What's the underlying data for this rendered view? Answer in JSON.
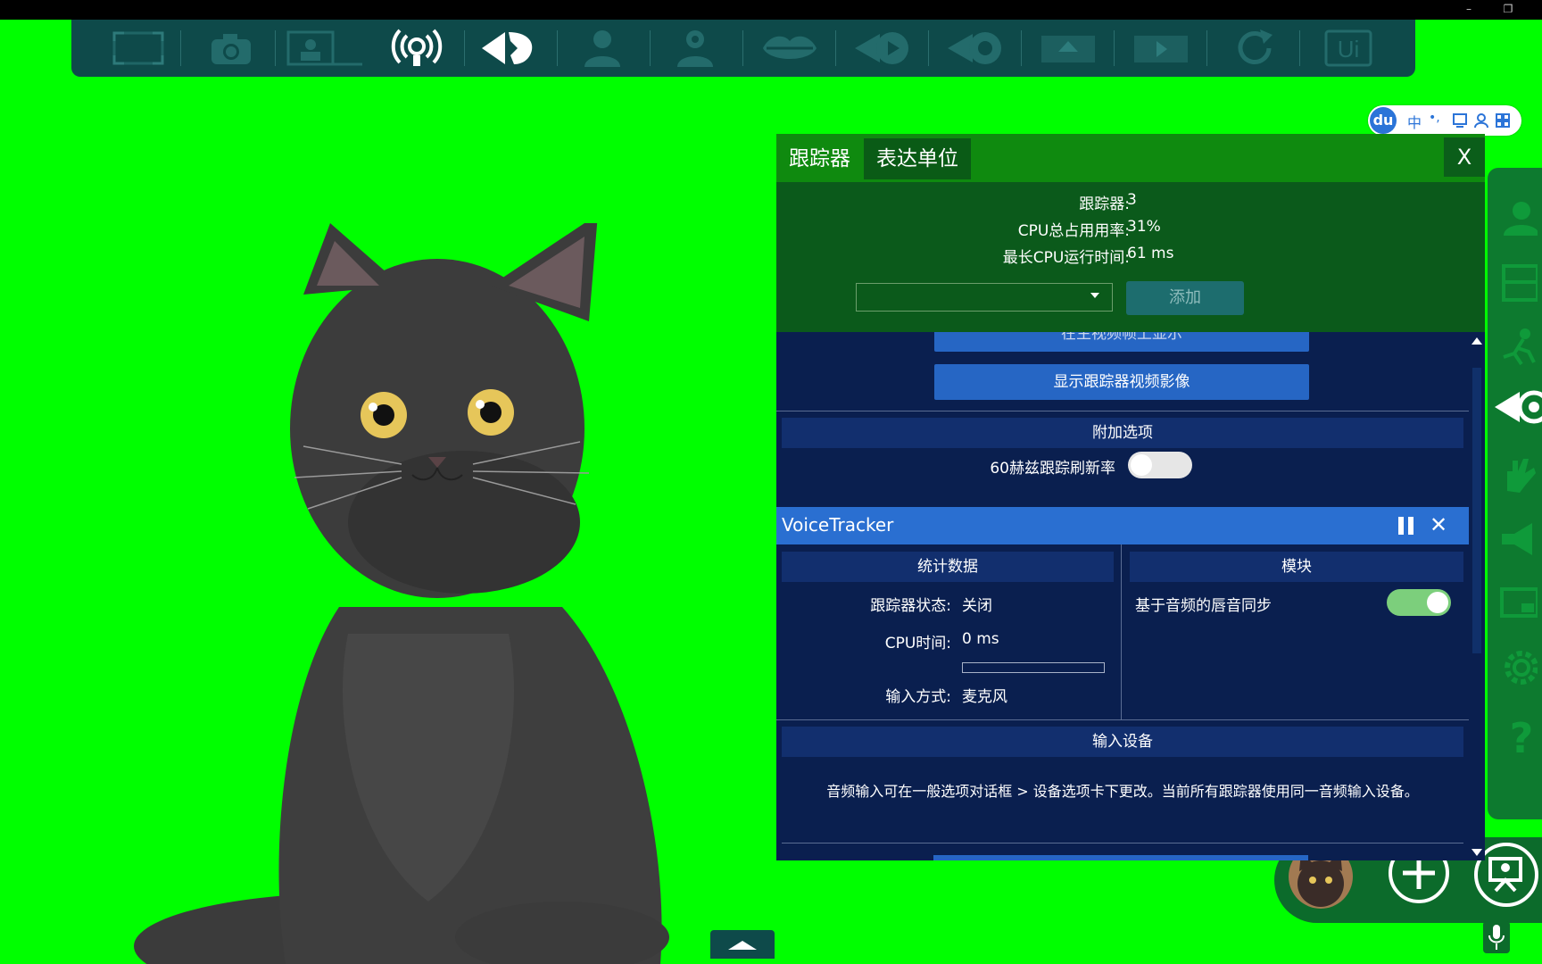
{
  "panel": {
    "tabs": [
      "跟踪器",
      "表达单位"
    ],
    "close_label": "X",
    "stats": {
      "trackers_label": "跟踪器:",
      "trackers_value": "3",
      "cpu_total_label": "CPU总占用用率:",
      "cpu_total_value": "31%",
      "max_cpu_label": "最长CPU运行时间:",
      "max_cpu_value": "61 ms"
    },
    "add_label": "添加",
    "show_main_label": "在主视频帧上显示",
    "show_tracker_video_label": "显示跟踪器视频影像",
    "extra_options_header": "附加选项",
    "refresh_60hz_label": "60赫兹跟踪刷新率",
    "refresh_60hz_on": false,
    "voice_tracker": {
      "title": "VoiceTracker",
      "stats_header": "统计数据",
      "modules_header": "模块",
      "status_label": "跟踪器状态:",
      "status_value": "关闭",
      "cpu_label": "CPU时间:",
      "cpu_value": "0 ms",
      "cpu_bar_fraction": 0.0,
      "input_label": "输入方式:",
      "input_value": "麦克风",
      "lipsync_label": "基于音频的唇音同步",
      "lipsync_on": true,
      "input_device_header": "输入设备",
      "input_note": "音频输入可在一般选项对话框 > 设备选项卡下更改。当前所有跟踪器使用同一音频输入设备。"
    }
  },
  "ime": {
    "logo": "du",
    "lang": "中",
    "punct": "•,"
  },
  "top_toolbar_icons": [
    "fullscreen-icon",
    "camera-icon",
    "picture-frame-icon",
    "broadcast-icon",
    "head-tracking-icon",
    "person-icon",
    "person-gear-icon",
    "lips-icon",
    "eye-play-icon",
    "eye-record-icon",
    "upload-icon",
    "video-icon",
    "refresh-icon",
    "ui-icon"
  ],
  "colors": {
    "chroma": "#00ff00",
    "toolbar": "#0e4a4a",
    "panel_green": "#0b5a1b",
    "panel_blue": "#0a1f4f",
    "accent_blue": "#2666c4",
    "toggle_on": "#7ccf7c"
  }
}
